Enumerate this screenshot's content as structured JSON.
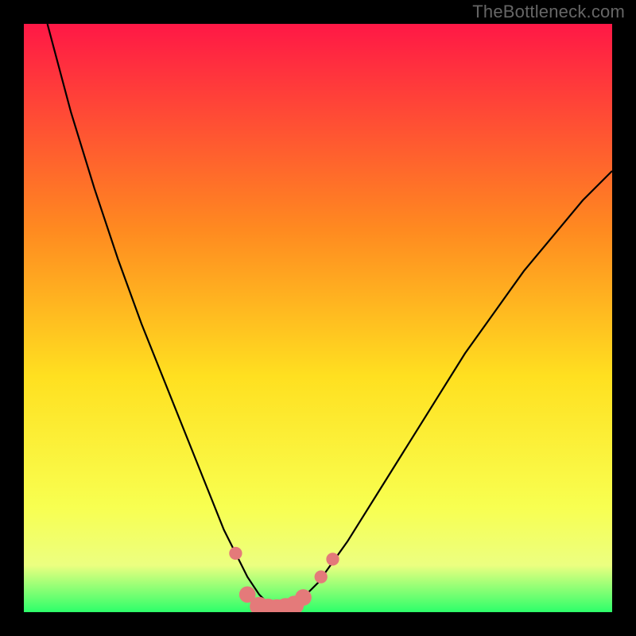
{
  "watermark": "TheBottleneck.com",
  "colors": {
    "frame_bg": "#000000",
    "grad_top": "#ff1846",
    "grad_mid1": "#ff8a20",
    "grad_mid2": "#ffe020",
    "grad_low1": "#f8ff50",
    "grad_low2": "#ecff80",
    "grad_bottom": "#2dff6a",
    "curve": "#000000",
    "marker_fill": "#e47a7a",
    "marker_stroke": "#c85a5a"
  },
  "chart_data": {
    "type": "line",
    "title": "",
    "xlabel": "",
    "ylabel": "",
    "xlim": [
      0,
      100
    ],
    "ylim": [
      0,
      100
    ],
    "series": [
      {
        "name": "bottleneck-curve",
        "x": [
          4,
          8,
          12,
          16,
          20,
          24,
          28,
          30,
          32,
          34,
          36,
          38,
          40,
          42,
          44,
          46,
          50,
          55,
          60,
          65,
          70,
          75,
          80,
          85,
          90,
          95,
          100
        ],
        "y": [
          100,
          85,
          72,
          60,
          49,
          39,
          29,
          24,
          19,
          14,
          10,
          6,
          3,
          1,
          0,
          1,
          5,
          12,
          20,
          28,
          36,
          44,
          51,
          58,
          64,
          70,
          75
        ]
      }
    ],
    "markers": [
      {
        "x": 36,
        "y": 10,
        "r": 1.1
      },
      {
        "x": 38,
        "y": 3,
        "r": 1.4
      },
      {
        "x": 40,
        "y": 1,
        "r": 1.6
      },
      {
        "x": 41.5,
        "y": 0.5,
        "r": 1.8
      },
      {
        "x": 43,
        "y": 0.4,
        "r": 1.8
      },
      {
        "x": 44.5,
        "y": 0.6,
        "r": 1.8
      },
      {
        "x": 46,
        "y": 1.2,
        "r": 1.6
      },
      {
        "x": 47.5,
        "y": 2.5,
        "r": 1.4
      },
      {
        "x": 50.5,
        "y": 6,
        "r": 1.1
      },
      {
        "x": 52.5,
        "y": 9,
        "r": 1.1
      }
    ]
  }
}
